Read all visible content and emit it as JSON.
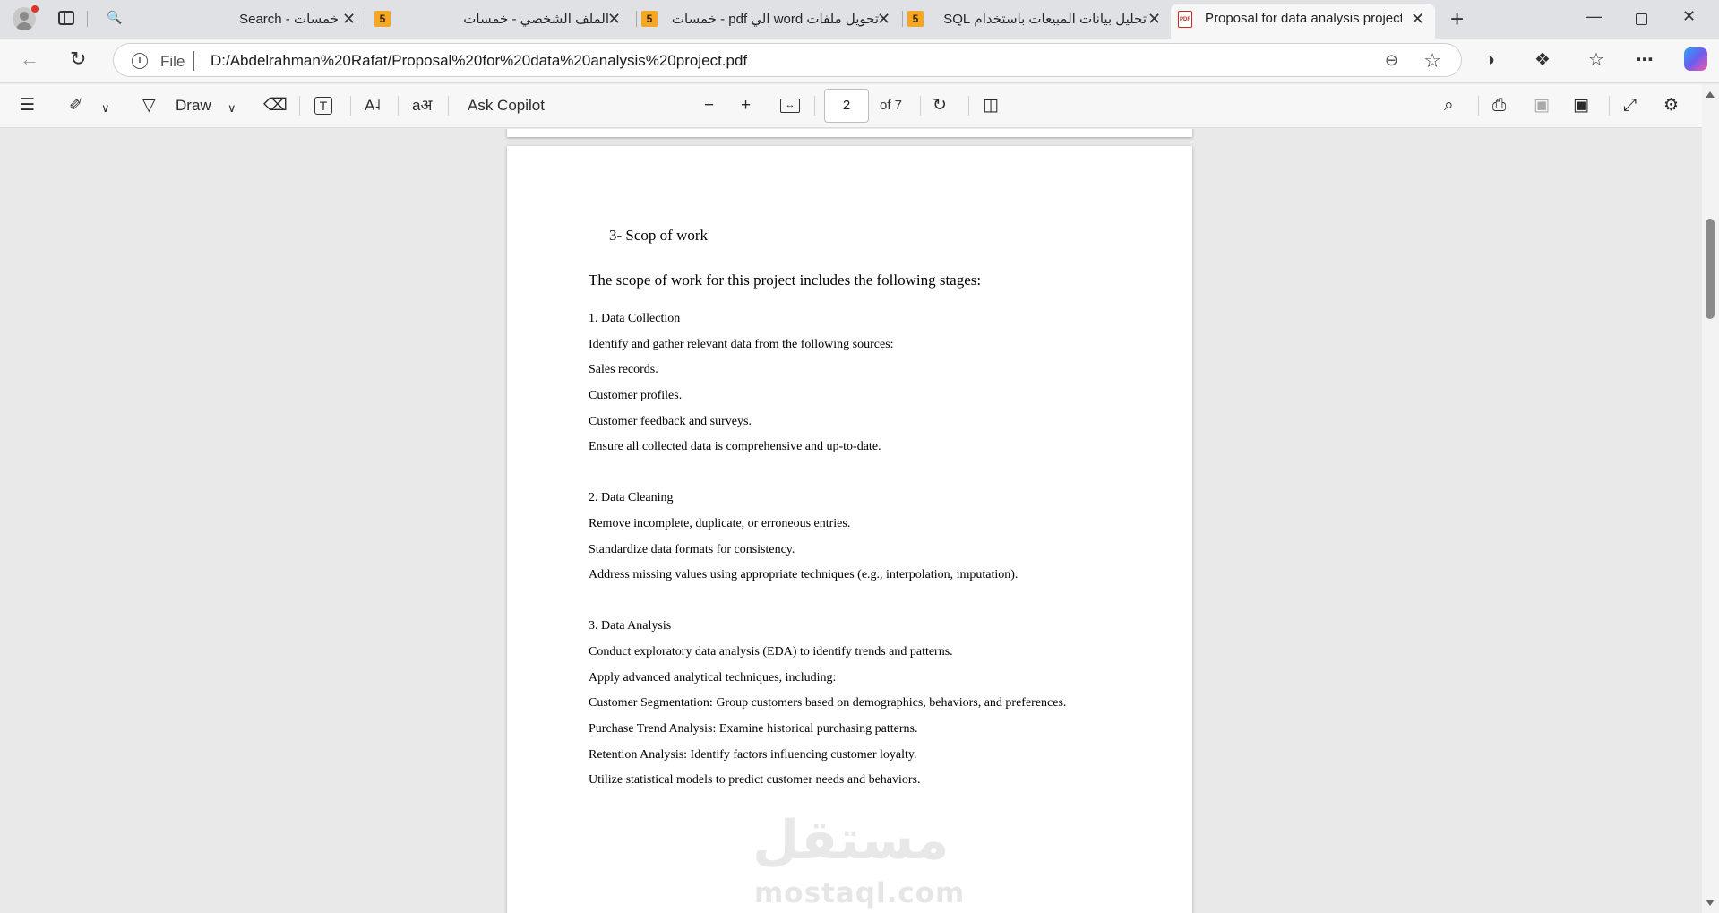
{
  "browser": {
    "tabs": [
      {
        "title": "خمسات - Search",
        "favicon": "search-icon"
      },
      {
        "title": "الملف الشخصي - خمسات",
        "favicon": "5"
      },
      {
        "title": "تحويل ملفات word الي pdf - خمسات",
        "favicon": "5"
      },
      {
        "title": "تحليل بيانات المبيعات باستخدام SQL",
        "favicon": "5"
      },
      {
        "title": "Proposal for data analysis project",
        "favicon": "pdf-icon",
        "active": true
      }
    ],
    "address": {
      "scheme_label": "File",
      "url": "D:/Abdelrahman%20Rafat/Proposal%20for%20data%20analysis%20project.pdf"
    }
  },
  "pdf_toolbar": {
    "draw_label": "Draw",
    "ask_copilot_label": "Ask Copilot",
    "current_page": "2",
    "page_total": "of 7"
  },
  "document": {
    "heading": "3-  Scop of work",
    "intro": "The scope of work for this project includes the following stages:",
    "lines": [
      "1. Data Collection",
      "Identify and gather relevant data from the following sources:",
      "Sales records.",
      "Customer profiles.",
      "Customer feedback and surveys.",
      "Ensure all collected data is comprehensive and up-to-date.",
      "2. Data Cleaning",
      "Remove incomplete, duplicate, or erroneous entries.",
      "Standardize data formats for consistency.",
      "Address missing values using appropriate techniques (e.g., interpolation, imputation).",
      "3. Data Analysis",
      "Conduct exploratory data analysis (EDA) to identify trends and patterns.",
      "Apply advanced analytical techniques, including:",
      "Customer Segmentation: Group customers based on demographics, behaviors, and preferences.",
      "Purchase Trend Analysis: Examine historical purchasing patterns.",
      "Retention Analysis: Identify factors influencing customer loyalty.",
      "Utilize statistical models to predict customer needs and behaviors."
    ],
    "watermark_arabic": "مستقل",
    "watermark_latin": "mostaql.com"
  }
}
